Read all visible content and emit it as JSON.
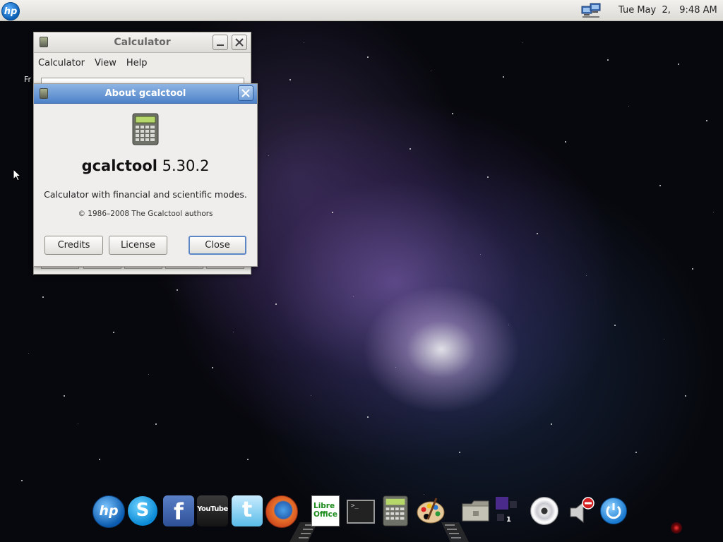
{
  "top_panel": {
    "hp_menu_label": "hp",
    "clock": "Tue May  2,   9:48 AM"
  },
  "calculator_window": {
    "title": "Calculator",
    "menu": [
      "Calculator",
      "View",
      "Help"
    ]
  },
  "desktop_label": "Fr",
  "about_dialog": {
    "title": "About gcalctool",
    "app_name": "gcalctool",
    "version": "5.30.2",
    "comment": "Calculator with financial and scientific modes.",
    "copyright": "© 1986–2008 The Gcalctool authors",
    "buttons": {
      "credits": "Credits",
      "license": "License",
      "close": "Close"
    }
  },
  "dock": {
    "items": [
      {
        "icon": "hp-icon",
        "label": "hp"
      },
      {
        "icon": "skype-icon",
        "label": ""
      },
      {
        "icon": "facebook-icon",
        "label": "f"
      },
      {
        "icon": "youtube-icon",
        "label": "YouTube"
      },
      {
        "icon": "twitter-icon",
        "label": ""
      },
      {
        "icon": "firefox-icon",
        "label": ""
      },
      {
        "icon": "libreoffice-icon",
        "label": "Libre Office"
      },
      {
        "icon": "terminal-icon",
        "label": ""
      },
      {
        "icon": "calculator-icon",
        "label": ""
      },
      {
        "icon": "paint-icon",
        "label": ""
      },
      {
        "icon": "folder-icon",
        "label": ""
      },
      {
        "icon": "workspace-icon",
        "label": "1"
      },
      {
        "icon": "cd-icon",
        "label": ""
      },
      {
        "icon": "volume-muted-icon",
        "label": ""
      },
      {
        "icon": "power-icon",
        "label": ""
      }
    ]
  },
  "colors": {
    "panel": "#e6e4e0",
    "titlebar_active": "#4d82c8",
    "focus_border": "#5d87c4"
  }
}
